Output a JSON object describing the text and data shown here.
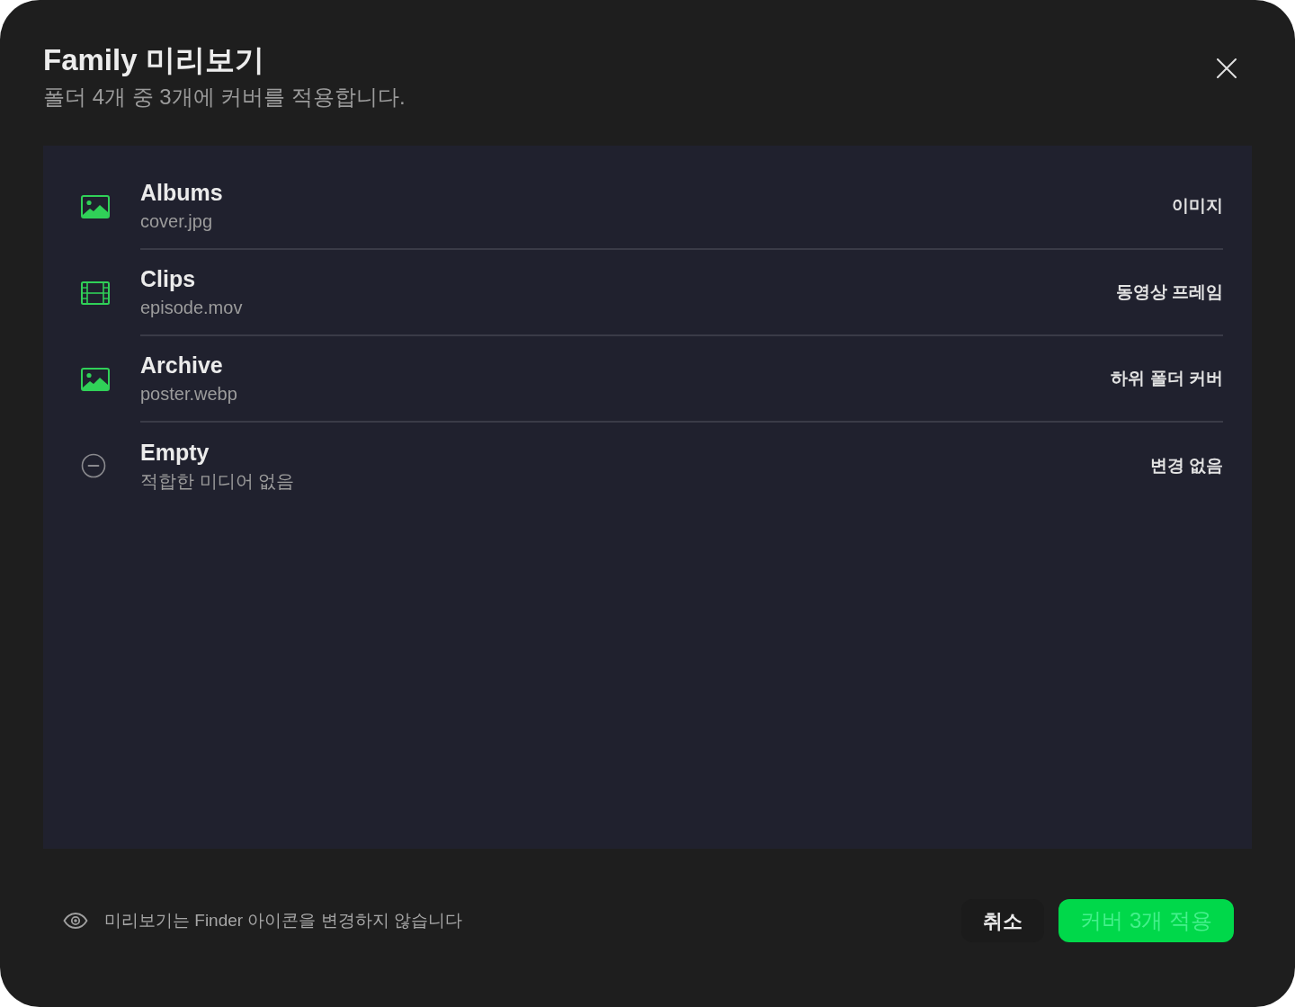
{
  "dialog": {
    "title": "Family 미리보기",
    "subtitle": "폴더 4개 중 3개에 커버를 적용합니다."
  },
  "folders": [
    {
      "kind": "image",
      "name": "Albums",
      "source": "cover.jpg",
      "cover_type": "이미지"
    },
    {
      "kind": "video",
      "name": "Clips",
      "source": "episode.mov",
      "cover_type": "동영상 프레임"
    },
    {
      "kind": "image",
      "name": "Archive",
      "source": "poster.webp",
      "cover_type": "하위 폴더 커버"
    },
    {
      "kind": "none",
      "name": "Empty",
      "source": "적합한 미디어 없음",
      "cover_type": "변경 없음"
    }
  ],
  "footer": {
    "note": "미리보기는 Finder 아이콘을 변경하지 않습니다",
    "buttons": [
      {
        "kind": "secondary",
        "label": "취소"
      },
      {
        "kind": "primary",
        "label": "커버 3개 적용"
      }
    ]
  }
}
